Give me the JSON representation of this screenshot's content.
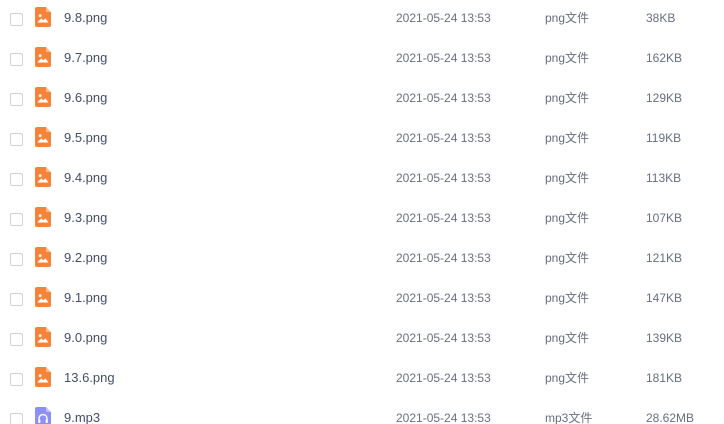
{
  "files": [
    {
      "name": "9.8.png",
      "modified": "2021-05-24 13:53",
      "type": "png文件",
      "size": "38KB",
      "icon": "image-file-icon",
      "icon_color": "#f7833a"
    },
    {
      "name": "9.7.png",
      "modified": "2021-05-24 13:53",
      "type": "png文件",
      "size": "162KB",
      "icon": "image-file-icon",
      "icon_color": "#f7833a"
    },
    {
      "name": "9.6.png",
      "modified": "2021-05-24 13:53",
      "type": "png文件",
      "size": "129KB",
      "icon": "image-file-icon",
      "icon_color": "#f7833a"
    },
    {
      "name": "9.5.png",
      "modified": "2021-05-24 13:53",
      "type": "png文件",
      "size": "119KB",
      "icon": "image-file-icon",
      "icon_color": "#f7833a"
    },
    {
      "name": "9.4.png",
      "modified": "2021-05-24 13:53",
      "type": "png文件",
      "size": "113KB",
      "icon": "image-file-icon",
      "icon_color": "#f7833a"
    },
    {
      "name": "9.3.png",
      "modified": "2021-05-24 13:53",
      "type": "png文件",
      "size": "107KB",
      "icon": "image-file-icon",
      "icon_color": "#f7833a"
    },
    {
      "name": "9.2.png",
      "modified": "2021-05-24 13:53",
      "type": "png文件",
      "size": "121KB",
      "icon": "image-file-icon",
      "icon_color": "#f7833a"
    },
    {
      "name": "9.1.png",
      "modified": "2021-05-24 13:53",
      "type": "png文件",
      "size": "147KB",
      "icon": "image-file-icon",
      "icon_color": "#f7833a"
    },
    {
      "name": "9.0.png",
      "modified": "2021-05-24 13:53",
      "type": "png文件",
      "size": "139KB",
      "icon": "image-file-icon",
      "icon_color": "#f7833a"
    },
    {
      "name": "13.6.png",
      "modified": "2021-05-24 13:53",
      "type": "png文件",
      "size": "181KB",
      "icon": "image-file-icon",
      "icon_color": "#f7833a"
    },
    {
      "name": "9.mp3",
      "modified": "2021-05-24 13:53",
      "type": "mp3文件",
      "size": "28.62MB",
      "icon": "audio-file-icon",
      "icon_color": "#8c8ff5"
    }
  ]
}
